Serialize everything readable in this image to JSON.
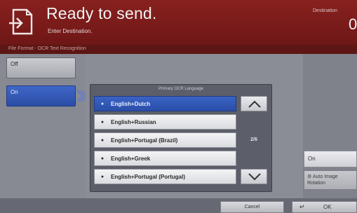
{
  "header": {
    "title": "Ready to send.",
    "subtitle": "Enter Destination.",
    "destination_label": "Destination",
    "destination_count": "0",
    "icon": "document-send-icon"
  },
  "section": {
    "title": "File Format - OCR Text Recognition"
  },
  "options": {
    "off_label": "Off",
    "on_label": "On"
  },
  "language_panel": {
    "title": "Primary OCR Language",
    "items": [
      {
        "label": "English+Dutch",
        "selected": true
      },
      {
        "label": "English+Russian",
        "selected": false
      },
      {
        "label": "English+Portugal (Brazil)",
        "selected": false
      },
      {
        "label": "English+Greek",
        "selected": false
      },
      {
        "label": "English+Portugal (Portugal)",
        "selected": false
      }
    ],
    "page_indicator": "2/6",
    "scroll_up_icon": "chevron-up-icon",
    "scroll_down_icon": "chevron-down-icon"
  },
  "rotation": {
    "on_label": "On",
    "label": "Auto Image Rotation"
  },
  "footer": {
    "cancel_label": "Cancel",
    "ok_label": "OK"
  },
  "colors": {
    "header_bg": "#7a1b1a",
    "selected_blue": "#2f57b8"
  }
}
